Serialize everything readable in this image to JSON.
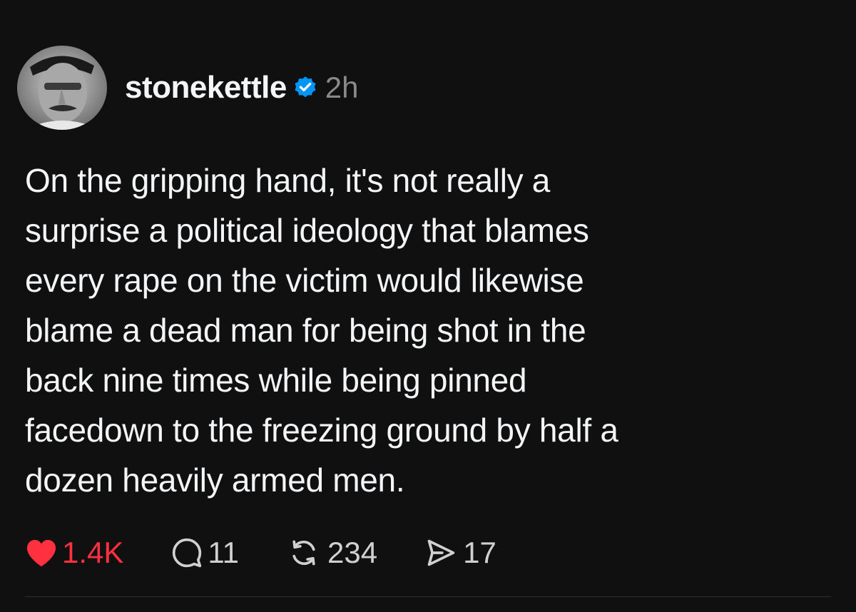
{
  "post": {
    "username": "stonekettle",
    "time": "2h",
    "text": "On the gripping hand, it's not really a\nsurprise a political ideology that blames\nevery rape on the victim would likewise\nblame a dead man for being shot in the\nback nine times while being pinned\nfacedown to the freezing ground by half a\ndozen heavily armed men.",
    "stats": {
      "likes": "1.4K",
      "replies": "11",
      "reposts": "234",
      "shares": "17"
    }
  },
  "colors": {
    "background": "#101010",
    "text": "#f3f5f7",
    "muted": "#8a8a8a",
    "like": "#ff3040",
    "verified": "#0095f6"
  },
  "icons": {
    "verified": "verified-badge-icon",
    "like": "heart-icon",
    "reply": "comment-icon",
    "repost": "repost-icon",
    "share": "send-icon"
  }
}
